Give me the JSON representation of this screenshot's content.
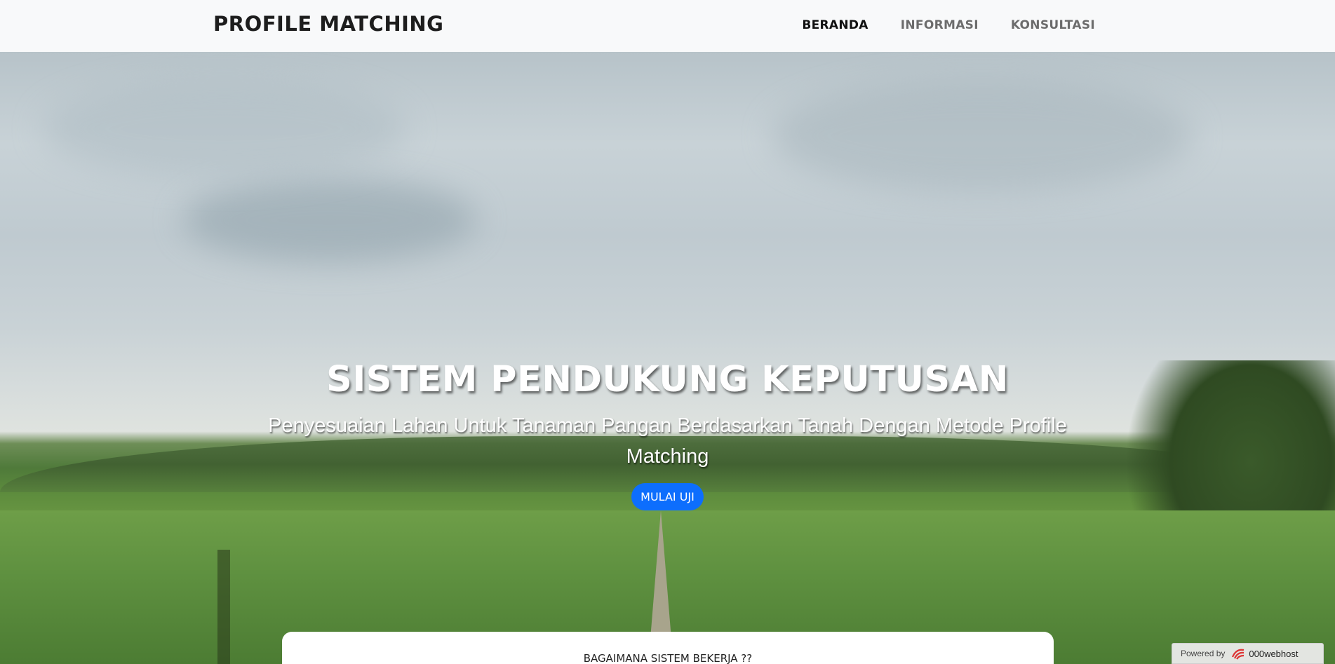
{
  "navbar": {
    "brand": "PROFILE MATCHING",
    "links": [
      {
        "label": "BERANDA",
        "active": true
      },
      {
        "label": "INFORMASI",
        "active": false
      },
      {
        "label": "KONSULTASI",
        "active": false
      }
    ]
  },
  "hero": {
    "title": "SISTEM PENDUKUNG KEPUTUSAN",
    "subtitle": "Penyesuaian Lahan Untuk Tanaman Pangan Berdasarkan Tanah Dengan Metode Profile Matching",
    "button_label": "MULAI UJI"
  },
  "card": {
    "title": "BAGAIMANA SISTEM BEKERJA ??"
  },
  "footer_badge": {
    "label": "Powered by",
    "brand": "000webhost"
  },
  "colors": {
    "accent": "#0d6efd",
    "navbar_bg": "#f8f9fa"
  }
}
